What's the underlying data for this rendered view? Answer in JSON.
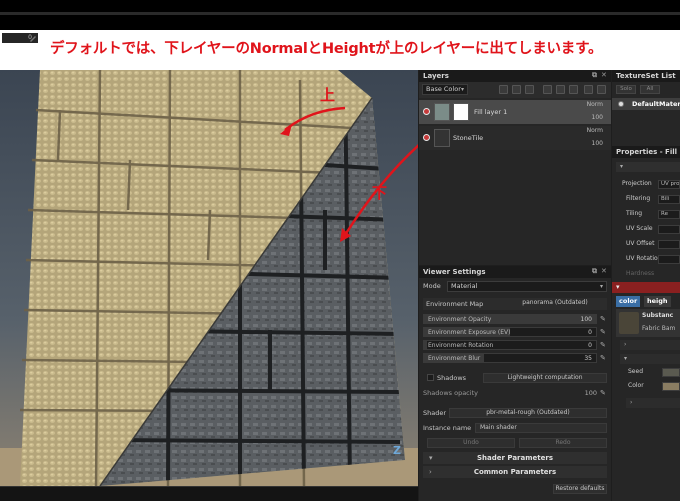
{
  "toolbar": {
    "value": "0"
  },
  "annotation": "デフォルトでは、下レイヤーのNormalとHeightが上のレイヤーに出てしまいます。",
  "viewport": {
    "label_top": "上",
    "label_bottom": "下",
    "gizmo": "Z"
  },
  "layers": {
    "title": "Layers",
    "channel": "Base Color",
    "items": [
      {
        "name": "Fill layer 1",
        "blend": "Norm",
        "opacity": "100"
      },
      {
        "name": "StoneTile",
        "blend": "Norm",
        "opacity": "100"
      }
    ]
  },
  "textureset": {
    "title": "TextureSet List",
    "btn_solo": "Solo",
    "btn_all": "All",
    "item": "DefaultMaterial"
  },
  "properties": {
    "title": "Properties - Fill",
    "rows": [
      {
        "label": "Projection",
        "value": "UV proj"
      },
      {
        "label": "Filtering",
        "value": "Bili"
      },
      {
        "label": "Tiling",
        "value": "Re"
      },
      {
        "label": "UV Scale",
        "value": ""
      },
      {
        "label": "UV Offset",
        "value": ""
      },
      {
        "label": "UV Rotation",
        "value": ""
      },
      {
        "label": "Hardness",
        "value": ""
      }
    ],
    "chip_color": "color",
    "chip_height": "heigh",
    "substance_title": "Substanc",
    "substance_name": "Fabric Bam",
    "seed_label": "Seed",
    "color_label": "Color"
  },
  "viewer": {
    "title": "Viewer Settings",
    "mode_label": "Mode",
    "mode_value": "Material",
    "env_map_label": "Environment Map",
    "env_map_value": "panorama (Outdated)",
    "sliders": [
      {
        "label": "Environment Opacity",
        "value": "100",
        "level": 1.0
      },
      {
        "label": "Environment Exposure (EV)",
        "value": "0",
        "level": 0.5
      },
      {
        "label": "Environment Rotation",
        "value": "0",
        "level": 0.0
      },
      {
        "label": "Environment Blur",
        "value": "35",
        "level": 0.35
      }
    ],
    "shadows_label": "Shadows",
    "shadows_value": "Lightweight computation",
    "shadows_opacity_label": "Shadows opacity",
    "shadows_opacity_value": "100",
    "shader_label": "Shader",
    "shader_value": "pbr-metal-rough (Outdated)",
    "instance_label": "Instance name",
    "instance_value": "Main shader",
    "undo": "Undo",
    "redo": "Redo",
    "shader_params": "Shader Parameters",
    "common_params": "Common Parameters",
    "restore": "Restore defaults"
  },
  "colors": {
    "annotation": "#e0141b",
    "eye": "#c73b3b",
    "accent_bar": "#8a2020"
  }
}
